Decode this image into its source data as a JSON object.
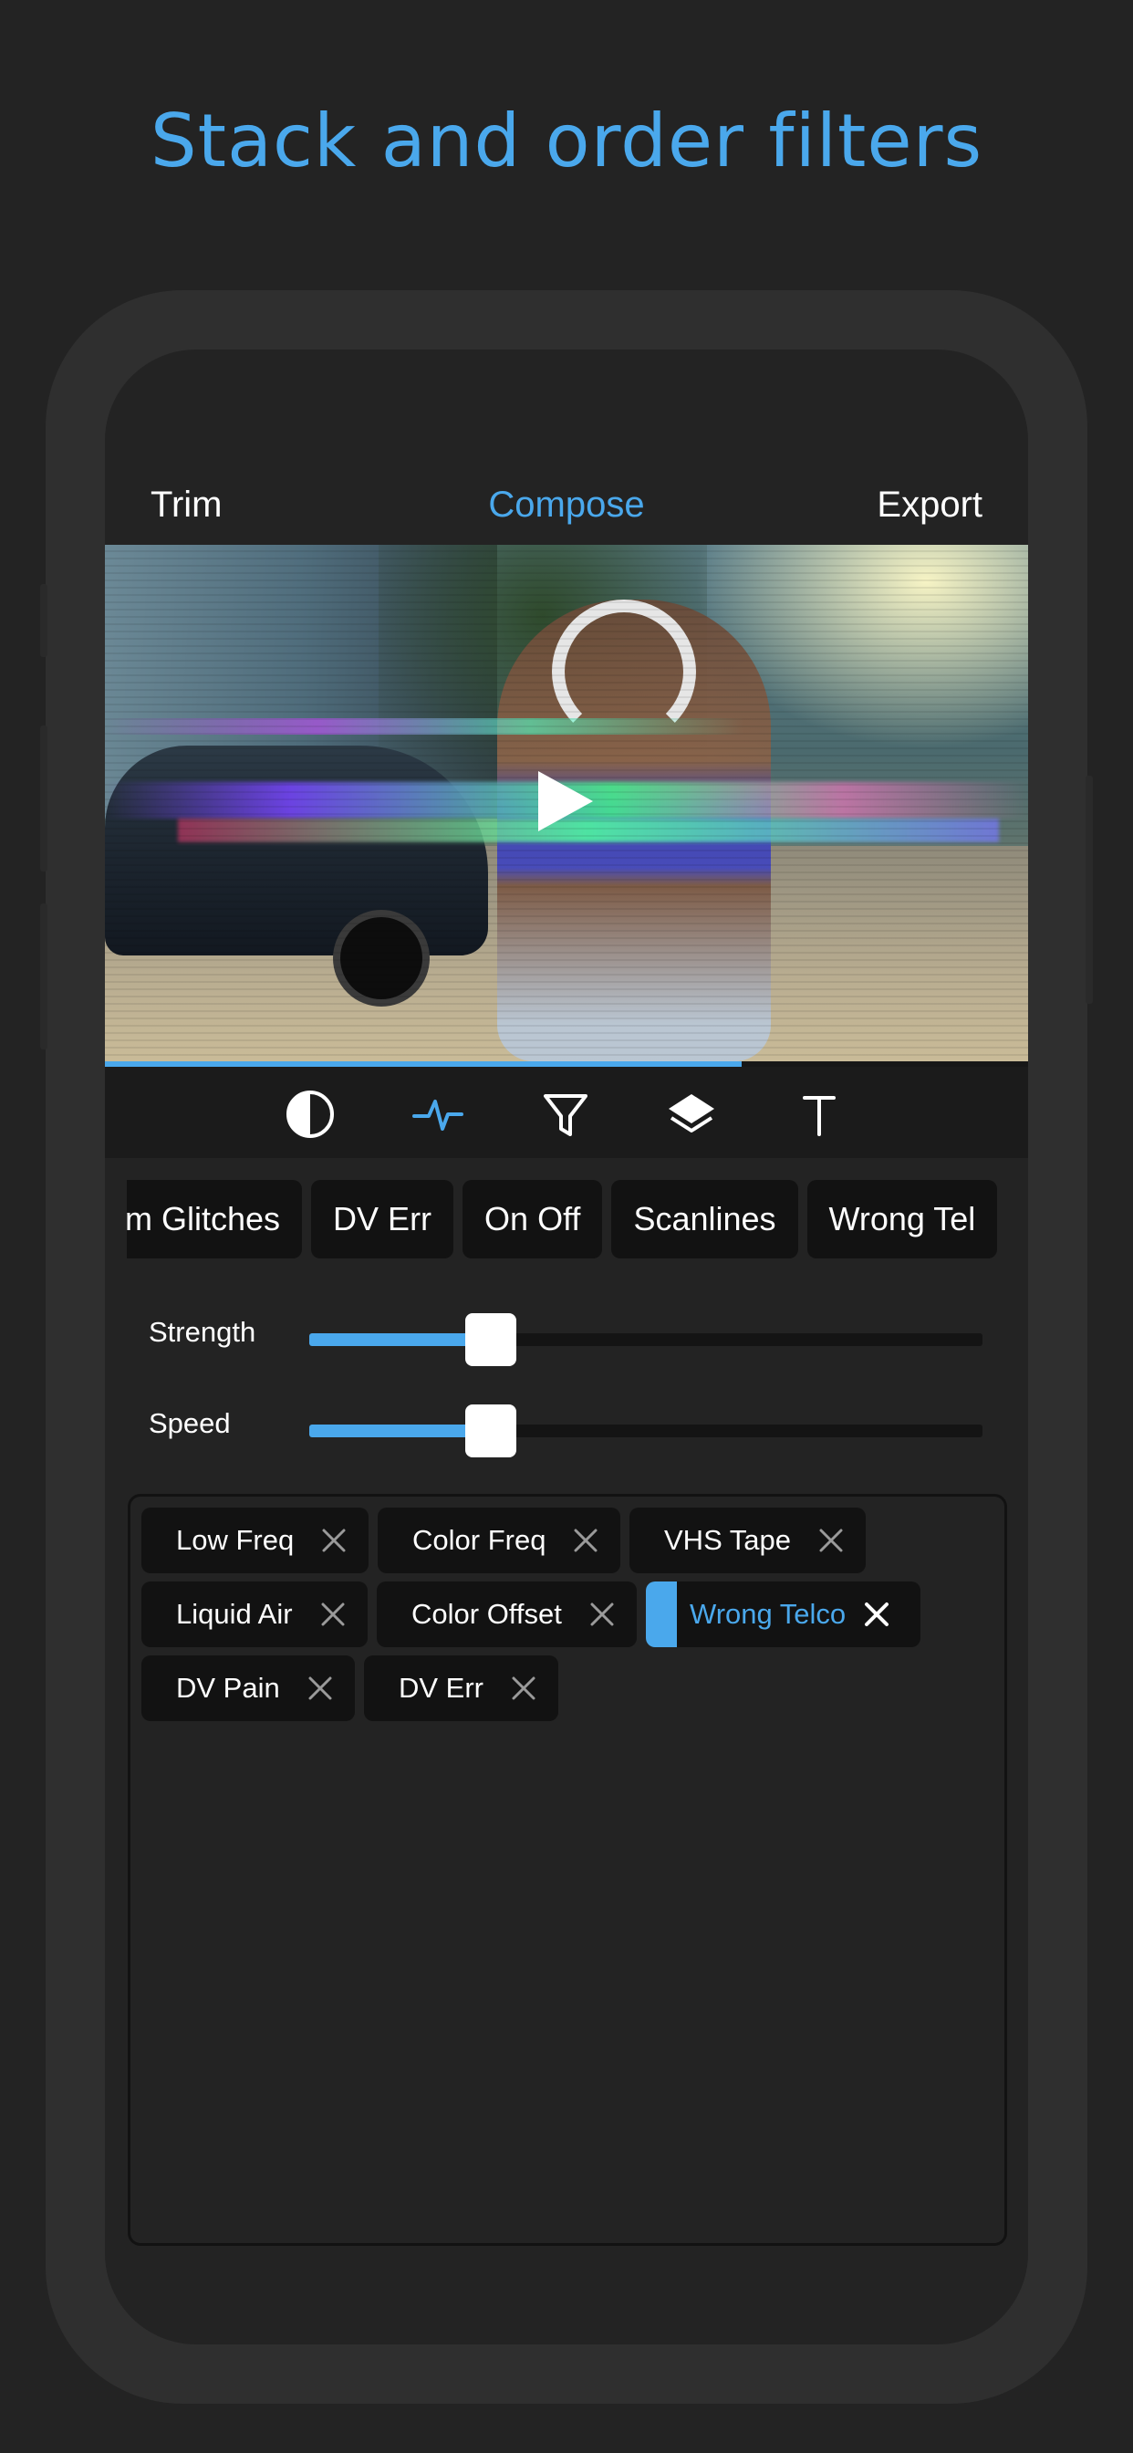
{
  "headline": "Stack and order filters",
  "colors": {
    "accent": "#4aa8ec",
    "background": "#232323",
    "chip_bg": "#121212",
    "frame": "#2f2f2f"
  },
  "nav": {
    "trim": "Trim",
    "compose": "Compose",
    "export": "Export",
    "active": "Compose"
  },
  "playback": {
    "progress": 0.69,
    "play_icon": "play-icon"
  },
  "tools": [
    {
      "name": "contrast-icon",
      "active": false
    },
    {
      "name": "waveform-icon",
      "active": true
    },
    {
      "name": "filter-funnel-icon",
      "active": false
    },
    {
      "name": "layers-icon",
      "active": false
    },
    {
      "name": "text-icon",
      "active": false
    }
  ],
  "filter_chips": [
    "m Glitches",
    "DV Err",
    "On Off",
    "Scanlines",
    "Wrong Tel"
  ],
  "sliders": [
    {
      "label": "Strength",
      "value": 0.27
    },
    {
      "label": "Speed",
      "value": 0.27
    }
  ],
  "stack": [
    {
      "label": "Low Freq",
      "active": false
    },
    {
      "label": "Color Freq",
      "active": false
    },
    {
      "label": "VHS Tape",
      "active": false
    },
    {
      "label": "Liquid Air",
      "active": false
    },
    {
      "label": "Color Offset",
      "active": false
    },
    {
      "label": "Wrong Telco",
      "active": true
    },
    {
      "label": "DV Pain",
      "active": false
    },
    {
      "label": "DV Err",
      "active": false
    }
  ]
}
